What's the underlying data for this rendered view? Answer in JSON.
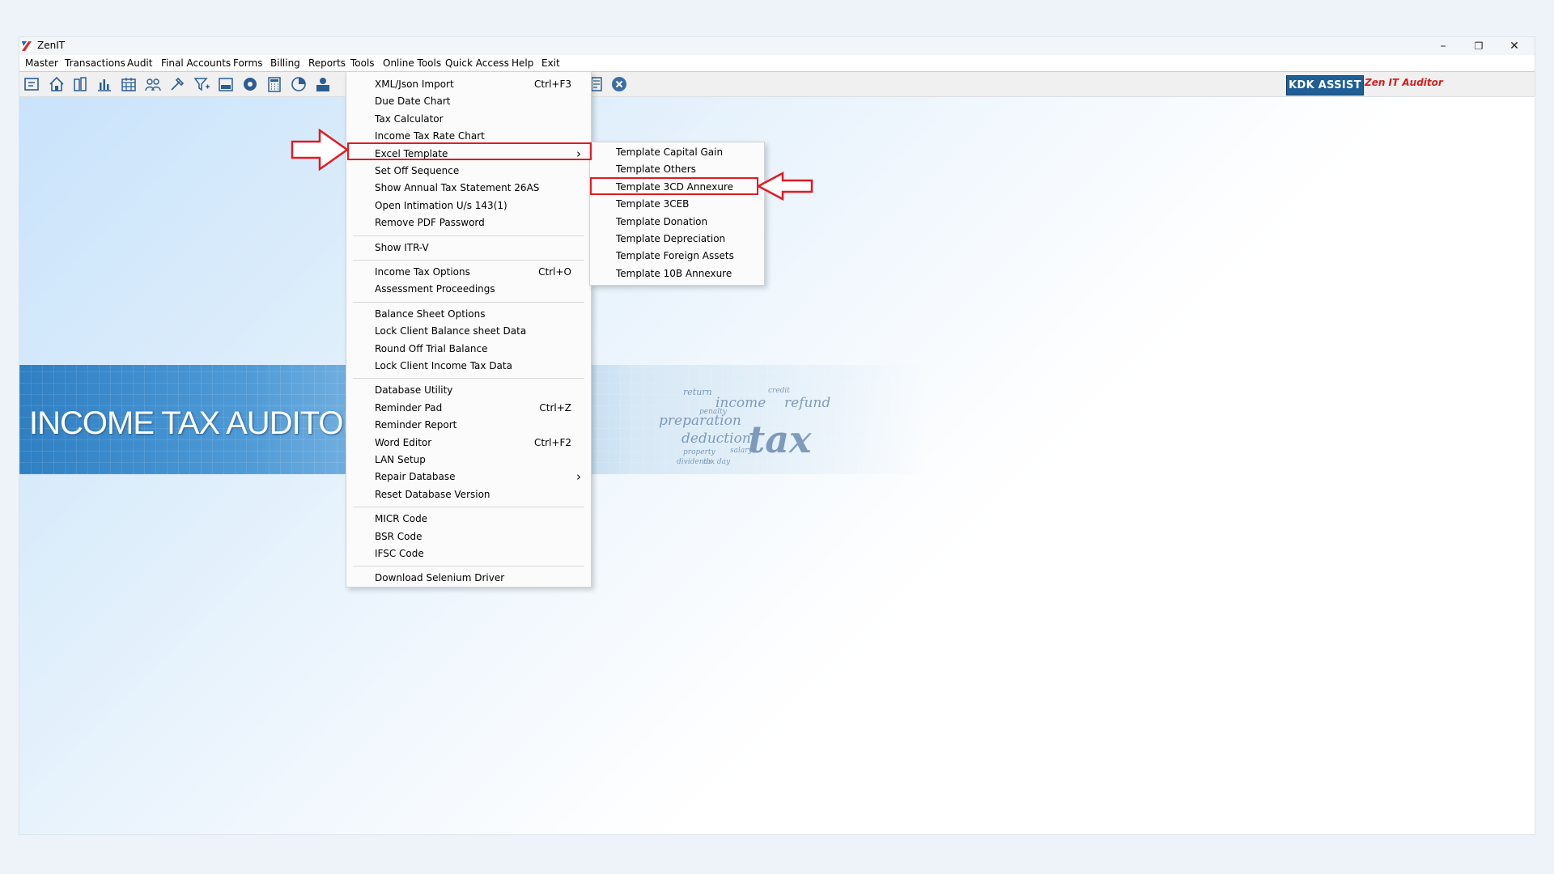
{
  "app": {
    "title": "ZenIT",
    "minimize": "–",
    "restore": "❐",
    "close": "✕"
  },
  "menubar": [
    "Master",
    "Transactions",
    "Audit",
    "Final Accounts",
    "Forms",
    "Billing",
    "Reports",
    "Tools",
    "Online Tools",
    "Quick Access",
    "Help",
    "Exit"
  ],
  "toolbar": {
    "kdk_button": "KDK ASSIST",
    "zen_label": "Zen IT Auditor",
    "icons": [
      "open-folder-icon",
      "home-icon",
      "building-icon",
      "bar-chart-icon",
      "calendar-icon",
      "users-icon",
      "tools-icon",
      "filter-icon",
      "tax-icon",
      "eye-icon",
      "calculator-icon",
      "pie-chart-icon",
      "pay-icon",
      "document-icon",
      "close-circle-icon"
    ]
  },
  "banner": {
    "title": "INCOME TAX AUDITOR",
    "collage_words": [
      "income",
      "refund",
      "preparation",
      "deduction",
      "return",
      "tax",
      "penalty",
      "salary",
      "credit",
      "property",
      "tax day",
      "dividends"
    ]
  },
  "tools_menu": {
    "groups": [
      [
        {
          "label": "XML/Json Import",
          "shortcut": "Ctrl+F3"
        },
        {
          "label": "Due Date Chart",
          "shortcut": ""
        },
        {
          "label": "Tax Calculator",
          "shortcut": ""
        },
        {
          "label": "Income Tax Rate Chart",
          "shortcut": ""
        },
        {
          "label": "Excel Template",
          "shortcut": "",
          "submenu": true
        },
        {
          "label": "Set Off Sequence",
          "shortcut": ""
        },
        {
          "label": "Show Annual Tax Statement 26AS",
          "shortcut": ""
        },
        {
          "label": "Open Intimation U/s 143(1)",
          "shortcut": ""
        },
        {
          "label": "Remove PDF Password",
          "shortcut": ""
        }
      ],
      [
        {
          "label": "Show ITR-V",
          "shortcut": ""
        }
      ],
      [
        {
          "label": "Income Tax Options",
          "shortcut": "Ctrl+O"
        },
        {
          "label": "Assessment Proceedings",
          "shortcut": ""
        }
      ],
      [
        {
          "label": "Balance Sheet Options",
          "shortcut": ""
        },
        {
          "label": "Lock Client Balance sheet Data",
          "shortcut": ""
        },
        {
          "label": "Round Off Trial Balance",
          "shortcut": ""
        },
        {
          "label": "Lock Client Income Tax Data",
          "shortcut": ""
        }
      ],
      [
        {
          "label": "Database Utility",
          "shortcut": ""
        },
        {
          "label": "Reminder Pad",
          "shortcut": "Ctrl+Z"
        },
        {
          "label": "Reminder Report",
          "shortcut": ""
        },
        {
          "label": "Word Editor",
          "shortcut": "Ctrl+F2"
        },
        {
          "label": "LAN Setup",
          "shortcut": ""
        },
        {
          "label": "Repair Database",
          "shortcut": "",
          "submenu": true
        },
        {
          "label": "Reset Database Version",
          "shortcut": ""
        }
      ],
      [
        {
          "label": "MICR Code",
          "shortcut": ""
        },
        {
          "label": "BSR Code",
          "shortcut": ""
        },
        {
          "label": "IFSC Code",
          "shortcut": ""
        }
      ],
      [
        {
          "label": "Download Selenium Driver",
          "shortcut": ""
        }
      ]
    ]
  },
  "excel_submenu": [
    "Template Capital Gain",
    "Template Others",
    "Template 3CD Annexure",
    "Template 3CEB",
    "Template Donation",
    "Template Depreciation",
    "Template Foreign Assets",
    "Template 10B Annexure"
  ],
  "colors": {
    "highlight": "#e01b24",
    "kdk_blue": "#1f5f95",
    "zen_red": "#d21f1f",
    "banner_blue": "#2f7fc3"
  }
}
